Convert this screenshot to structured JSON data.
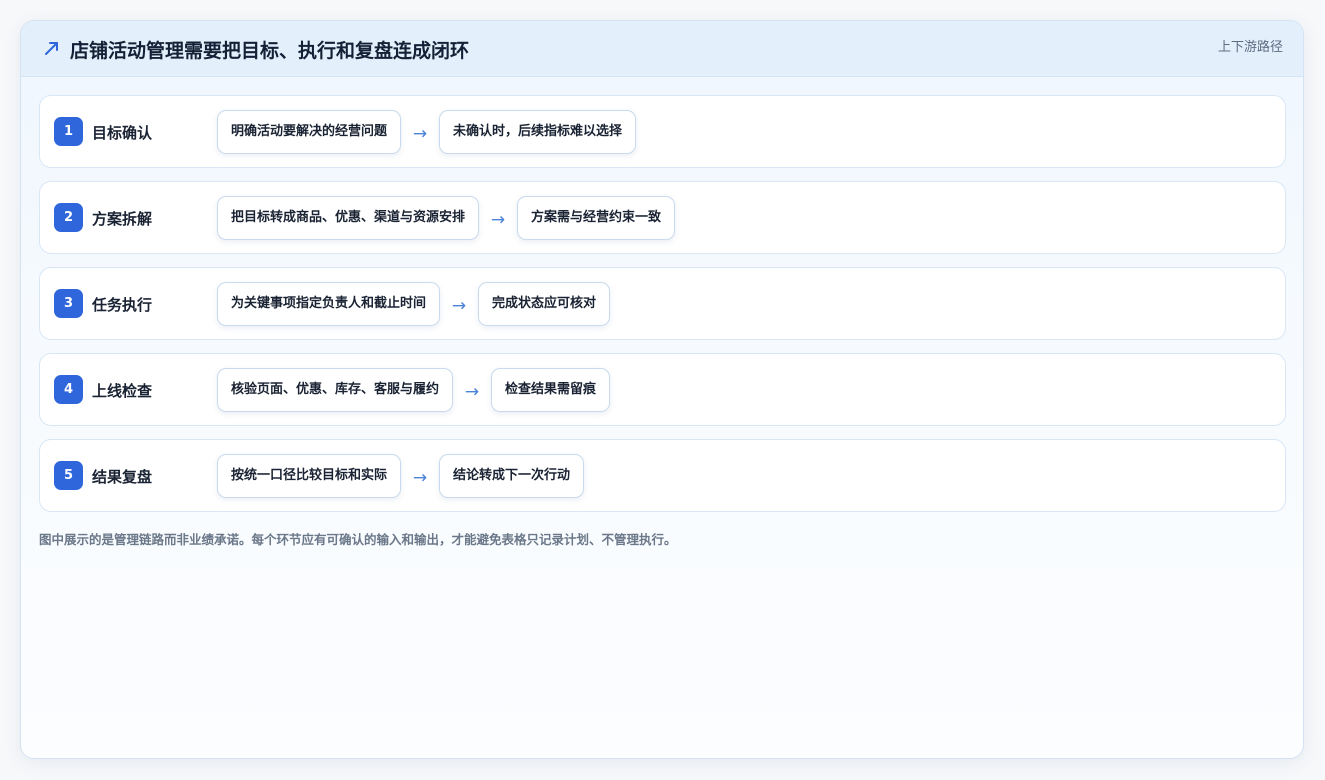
{
  "header": {
    "icon": "trend-arrow-icon",
    "title": "店铺活动管理需要把目标、执行和复盘连成闭环",
    "tag": "上下游路径"
  },
  "steps": [
    {
      "number": "1",
      "name": "目标确认",
      "action": "明确活动要解决的经营问题",
      "arrow": "→",
      "result": "未确认时，后续指标难以选择"
    },
    {
      "number": "2",
      "name": "方案拆解",
      "action": "把目标转成商品、优惠、渠道与资源安排",
      "arrow": "→",
      "result": "方案需与经营约束一致"
    },
    {
      "number": "3",
      "name": "任务执行",
      "action": "为关键事项指定负责人和截止时间",
      "arrow": "→",
      "result": "完成状态应可核对"
    },
    {
      "number": "4",
      "name": "上线检查",
      "action": "核验页面、优惠、库存、客服与履约",
      "arrow": "→",
      "result": "检查结果需留痕"
    },
    {
      "number": "5",
      "name": "结果复盘",
      "action": "按统一口径比较目标和实际",
      "arrow": "→",
      "result": "结论转成下一次行动"
    }
  ],
  "footnote": "图中展示的是管理链路而非业绩承诺。每个环节应有可确认的输入和输出，才能避免表格只记录计划、不管理执行。",
  "colors": {
    "accent": "#2f66db",
    "arrow": "#4a83d9",
    "header_bg": "#e3f0fc"
  }
}
